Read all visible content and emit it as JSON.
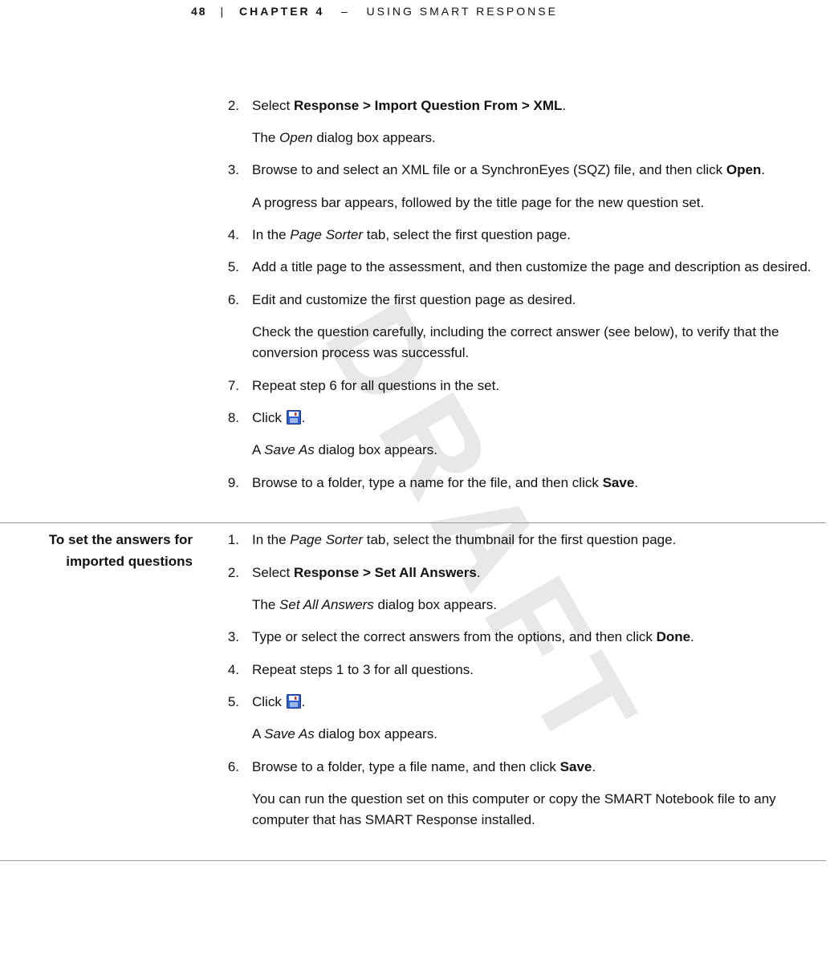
{
  "header": {
    "page_number": "48",
    "separator": "|",
    "chapter_label": "CHAPTER 4",
    "dash": "–",
    "chapter_title": "USING SMART RESPONSE"
  },
  "watermark": "DRAFT",
  "section1": {
    "side_label": "",
    "steps": [
      {
        "num": "2.",
        "parts": [
          {
            "t": "Select ",
            "style": ""
          },
          {
            "t": "Response > Import Question From > XML",
            "style": "b"
          },
          {
            "t": ".",
            "style": ""
          }
        ],
        "followups": [
          [
            {
              "t": "The ",
              "style": ""
            },
            {
              "t": "Open",
              "style": "it"
            },
            {
              "t": " dialog box appears.",
              "style": ""
            }
          ]
        ]
      },
      {
        "num": "3.",
        "parts": [
          {
            "t": "Browse to and select an XML file or a SynchronEyes (SQZ) file, and then click ",
            "style": ""
          },
          {
            "t": "Open",
            "style": "b"
          },
          {
            "t": ".",
            "style": ""
          }
        ],
        "followups": [
          [
            {
              "t": "A progress bar appears, followed by the title page for the new question set.",
              "style": ""
            }
          ]
        ]
      },
      {
        "num": "4.",
        "parts": [
          {
            "t": "In the ",
            "style": ""
          },
          {
            "t": "Page Sorter",
            "style": "it"
          },
          {
            "t": " tab, select the first question page.",
            "style": ""
          }
        ],
        "followups": []
      },
      {
        "num": "5.",
        "parts": [
          {
            "t": "Add a title page to the assessment, and then customize the page and description as desired.",
            "style": ""
          }
        ],
        "followups": []
      },
      {
        "num": "6.",
        "parts": [
          {
            "t": "Edit and customize the first question page as desired.",
            "style": ""
          }
        ],
        "followups": [
          [
            {
              "t": "Check the question carefully, including the correct answer (see below), to verify that the conversion process was successful.",
              "style": ""
            }
          ]
        ]
      },
      {
        "num": "7.",
        "parts": [
          {
            "t": "Repeat step 6 for all questions in the set.",
            "style": ""
          }
        ],
        "followups": []
      },
      {
        "num": "8.",
        "parts": [
          {
            "t": "Click ",
            "style": ""
          },
          {
            "t": "",
            "style": "save-icon"
          },
          {
            "t": ".",
            "style": ""
          }
        ],
        "followups": [
          [
            {
              "t": "A ",
              "style": ""
            },
            {
              "t": "Save As",
              "style": "it"
            },
            {
              "t": " dialog box appears.",
              "style": ""
            }
          ]
        ]
      },
      {
        "num": "9.",
        "parts": [
          {
            "t": "Browse to a folder, type a name for the file, and then click ",
            "style": ""
          },
          {
            "t": "Save",
            "style": "b"
          },
          {
            "t": ".",
            "style": ""
          }
        ],
        "followups": []
      }
    ]
  },
  "section2": {
    "side_label": "To set the answers for imported questions",
    "steps": [
      {
        "num": "1.",
        "parts": [
          {
            "t": "In the ",
            "style": ""
          },
          {
            "t": "Page Sorter",
            "style": "it"
          },
          {
            "t": " tab, select the thumbnail for the first question page.",
            "style": ""
          }
        ],
        "followups": []
      },
      {
        "num": "2.",
        "parts": [
          {
            "t": "Select ",
            "style": ""
          },
          {
            "t": "Response > Set All Answers",
            "style": "b"
          },
          {
            "t": ".",
            "style": ""
          }
        ],
        "followups": [
          [
            {
              "t": "The ",
              "style": ""
            },
            {
              "t": "Set All Answers",
              "style": "it"
            },
            {
              "t": " dialog box appears.",
              "style": ""
            }
          ]
        ]
      },
      {
        "num": "3.",
        "parts": [
          {
            "t": "Type or select the correct answers from the options, and then click ",
            "style": ""
          },
          {
            "t": "Done",
            "style": "b"
          },
          {
            "t": ".",
            "style": ""
          }
        ],
        "followups": []
      },
      {
        "num": "4.",
        "parts": [
          {
            "t": "Repeat steps 1 to 3 for all questions.",
            "style": ""
          }
        ],
        "followups": []
      },
      {
        "num": "5.",
        "parts": [
          {
            "t": "Click ",
            "style": ""
          },
          {
            "t": "",
            "style": "save-icon"
          },
          {
            "t": ".",
            "style": ""
          }
        ],
        "followups": [
          [
            {
              "t": "A ",
              "style": ""
            },
            {
              "t": "Save As",
              "style": "it"
            },
            {
              "t": " dialog box appears.",
              "style": ""
            }
          ]
        ]
      },
      {
        "num": "6.",
        "parts": [
          {
            "t": "Browse to a folder, type a file name, and then click ",
            "style": ""
          },
          {
            "t": "Save",
            "style": "b"
          },
          {
            "t": ".",
            "style": ""
          }
        ],
        "followups": [
          [
            {
              "t": "You can run the question set on this computer or copy the SMART Notebook file to any computer that has SMART Response installed.",
              "style": ""
            }
          ]
        ]
      }
    ]
  }
}
